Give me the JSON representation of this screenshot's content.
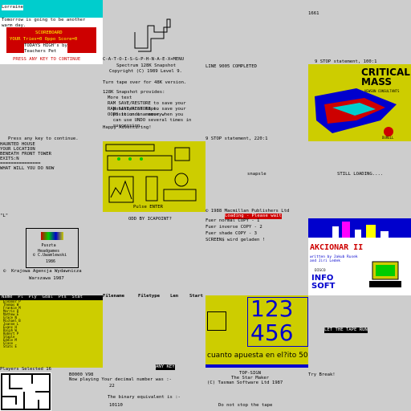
{
  "colors": {
    "bg": "#cdcdcd",
    "cyan": "#00cdcd",
    "red": "#cd0000",
    "yellow": "#cdcd00",
    "blue": "#0000cd",
    "magenta": "#cd00cd",
    "green": "#00cd00",
    "white": "#ffffff"
  },
  "t1": {
    "title": "Lorraine",
    "msg": "Tomorrow is going to be another\nwarm day.",
    "scoreboard": "SCOREBOARD",
    "scores": "YOUR Tries=0 Oppo Score=0",
    "high": "TODAYS HIGH's by\nTeachers Pet",
    "press": "PRESS ANY KEY TO CONTINUE"
  },
  "t2": {
    "counter": "1661"
  },
  "t3": {
    "loading": "C-A-T-O-I-S-G-P-H-N-A-E-X+MENU",
    "title": "Spectrum 128K Snapshot",
    "copy": "Copyright (C) 1989 Level 9.",
    "turn": "Turn tape over for 48K version.",
    "provides": "128K Snapshot provides:",
    "items": [
      "More text",
      "RAM SAVE/RESTORE to save your\n  position in memory.",
      "OOPS to undo a move when you\n  can use UNDO several times in\n  succession."
    ],
    "happy": "Happy Adventuring!",
    "ramsave": "RAM SAVE/RESTORE to save your\n  position on tape."
  },
  "t4": {
    "loaded": "LINE 9005 COMPLETED",
    "stop": "9 STOP statement, 100:1"
  },
  "t5": {
    "game": "CRITICAL MASS",
    "sub": "HEWSON CONSULTANTS",
    "credit": "DURELL"
  },
  "t6": {
    "press": "Press any key to continue.",
    "lines": [
      "HAUNTED HOUSE",
      "YOUR LOCATION",
      "BENEATH FRONT TOWER",
      "EXITS:N",
      "===============",
      "WHAT WILL YOU DO NOW"
    ]
  },
  "t7": {
    "stop": "9 STOP statement, 220:1",
    "pulse": "Pulse ENTER",
    "odd": "ODD BY ICAPOINT?"
  },
  "t8": {
    "word": "snapsle"
  },
  "t9": {
    "loading": "STILL LOADING...."
  },
  "t10": {
    "quote": "\"L\""
  },
  "t11": {
    "name": "Puszta\nHeadgames",
    "copy": "© C.Uwamlewski",
    "year": "1986",
    "agency": "©  Krajowa Agencja Wydawnicza",
    "city": "Warszawa 1987"
  },
  "t12": {
    "copy": "© 1988 Macmillan Publishers Ltd",
    "bar": "Loading - Please wait",
    "opts": [
      "Fuer normal COPY - 1",
      "Fuer inverse COPY - 2",
      "Fuer shade COPY - 3",
      "SCREEN$ wird geladen !"
    ]
  },
  "t13": {
    "title": "AKCIONAR II",
    "by": "written by Jakub Rusek\nand Jiri Ledek",
    "logo": "INFO\nSOFT",
    "disc": "DISCO"
  },
  "t14": {
    "headers": [
      "Name",
      "Pl",
      "Ply",
      "Goal",
      "Pts",
      "Stat"
    ],
    "rows": [
      "Eleanor P",
      "Thomas W",
      "Frankie M",
      "Morris D",
      "Mathew E",
      "Grace N",
      "Michael B",
      "Joanne L",
      "Evans H",
      "Ralph W",
      "Robert P",
      "Staple",
      "Eddie M",
      "Glase",
      "Stats E"
    ],
    "footer": "Players Selected 16",
    "key": "ANY KEY"
  },
  "t15": {
    "cols": [
      "Filename",
      "Filetype",
      "Len",
      "Start"
    ]
  },
  "t16": {
    "n1": "123",
    "n2": "456",
    "q": "cuanto apuesta en el?ito 5000!",
    "scn": "scan"
  },
  "t17": {
    "msg": "LET THE TAPE RUN"
  },
  "t18": {
    "l1": "B0000 V98",
    "l2": "Now playing Your decimal number was :-",
    "v1": "22",
    "l3": "The binary equivalent is :-",
    "v2": "10110"
  },
  "t19": {
    "a": "TOP-SIGN",
    "b": "The Star Maker",
    "c": "(C) Tasman Software Ltd 1987",
    "d": "Do not stop the tape"
  },
  "t20": {
    "msg": "Try Break!"
  }
}
